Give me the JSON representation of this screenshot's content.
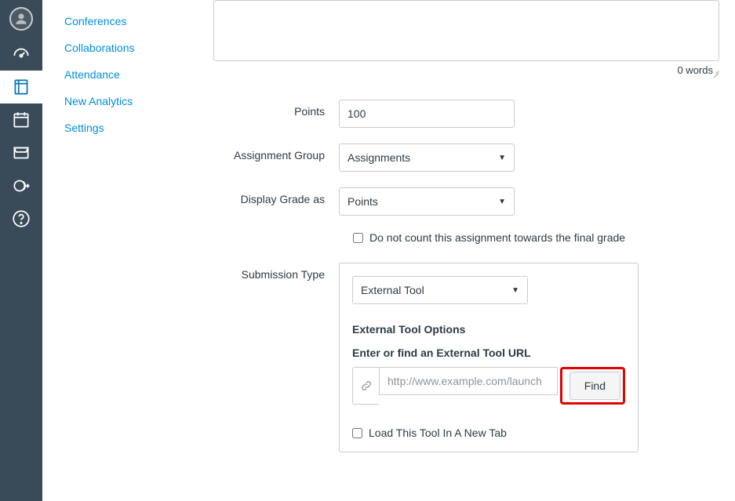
{
  "global_nav": {
    "items": [
      {
        "name": "account"
      },
      {
        "name": "dashboard"
      },
      {
        "name": "courses",
        "active": true
      },
      {
        "name": "calendar"
      },
      {
        "name": "inbox"
      },
      {
        "name": "commons"
      },
      {
        "name": "help"
      }
    ]
  },
  "course_nav": {
    "items": [
      {
        "label": "Conferences"
      },
      {
        "label": "Collaborations"
      },
      {
        "label": "Attendance"
      },
      {
        "label": "New Analytics"
      },
      {
        "label": "Settings"
      }
    ]
  },
  "editor": {
    "word_count": "0 words"
  },
  "form": {
    "points": {
      "label": "Points",
      "value": "100"
    },
    "group": {
      "label": "Assignment Group",
      "value": "Assignments"
    },
    "display": {
      "label": "Display Grade as",
      "value": "Points"
    },
    "exclude": {
      "label": "Do not count this assignment towards the final grade"
    },
    "submission": {
      "label": "Submission Type",
      "type_value": "External Tool",
      "ext_title": "External Tool Options",
      "ext_sub": "Enter or find an External Tool URL",
      "url_placeholder": "http://www.example.com/launch",
      "find_label": "Find",
      "new_tab_label": "Load This Tool In A New Tab"
    }
  }
}
